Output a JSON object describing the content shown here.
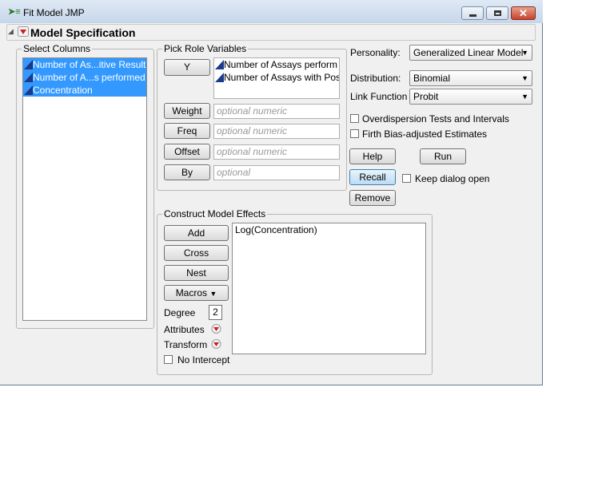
{
  "window": {
    "title": "Fit Model   JMP",
    "app_icon": "jmp-logo-icon"
  },
  "header": {
    "title": "Model Specification"
  },
  "select_columns": {
    "label": "Select Columns",
    "items": [
      {
        "label": "Number of As...itive Result",
        "selected": true
      },
      {
        "label": "Number of A...s performed",
        "selected": true
      },
      {
        "label": "Concentration",
        "selected": true
      }
    ]
  },
  "pick_roles": {
    "label": "Pick Role Variables",
    "y_button": "Y",
    "y_items": [
      "Number of Assays perform",
      "Number of Assays with Pos"
    ],
    "weight_button": "Weight",
    "weight_placeholder": "optional numeric",
    "freq_button": "Freq",
    "freq_placeholder": "optional numeric",
    "offset_button": "Offset",
    "offset_placeholder": "optional numeric",
    "by_button": "By",
    "by_placeholder": "optional"
  },
  "options": {
    "personality_label": "Personality:",
    "personality_value": "Generalized Linear Model",
    "distribution_label": "Distribution:",
    "distribution_value": "Binomial",
    "link_label": "Link Function",
    "link_value": "Probit",
    "overdispersion_label": "Overdispersion Tests and Intervals",
    "overdispersion_checked": false,
    "firth_label": "Firth Bias-adjusted Estimates",
    "firth_checked": false,
    "help_button": "Help",
    "run_button": "Run",
    "recall_button": "Recall",
    "keep_open_label": "Keep dialog open",
    "keep_open_checked": false,
    "remove_button": "Remove"
  },
  "effects": {
    "label": "Construct Model Effects",
    "add_button": "Add",
    "cross_button": "Cross",
    "nest_button": "Nest",
    "macros_button": "Macros",
    "degree_label": "Degree",
    "degree_value": "2",
    "attributes_label": "Attributes",
    "transform_label": "Transform",
    "no_intercept_label": "No Intercept",
    "no_intercept_checked": false,
    "items": [
      "Log(Concentration)"
    ]
  },
  "colors": {
    "selection": "#3399ff",
    "red_menu": "#cc1f1f"
  }
}
